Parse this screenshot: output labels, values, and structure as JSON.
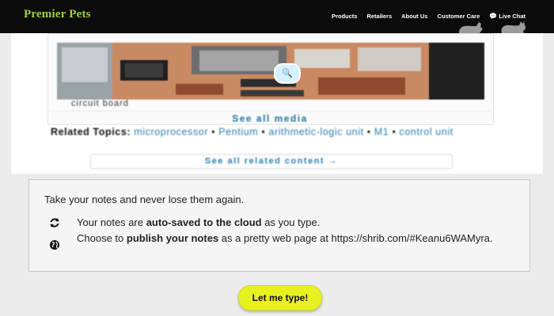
{
  "site": {
    "brand": "Premier Pets",
    "nav": [
      "Products",
      "Retailers",
      "About Us",
      "Customer Care",
      "Live Chat"
    ],
    "icons": {
      "live_chat": "chat-bubbles-icon",
      "pets": "cat-and-dog-silhouette-icon"
    },
    "colors": {
      "bar": "#0b0b0b",
      "brand": "#9bd43c"
    }
  },
  "article": {
    "media_caption": "circuit board",
    "see_all_media": "See all media",
    "related_label": "Related Topics:",
    "related_links": [
      "microprocessor",
      "Pentium",
      "arithmetic-logic unit",
      "M1",
      "control unit"
    ],
    "see_related": "See all related content →",
    "icons": {
      "zoom": "magnify-icon"
    }
  },
  "notes": {
    "intro": "Take your notes and never lose them again.",
    "feature1": {
      "icon": "refresh-icon",
      "pre": "Your notes are ",
      "bold": "auto-saved to the cloud",
      "post": " as you type."
    },
    "feature2": {
      "icon": "globe-icon",
      "pre": "Choose to ",
      "bold": "publish your notes",
      "post": " as a pretty web page at https://shrib.com/#Keanu6WAMyra."
    }
  },
  "cta": {
    "label": "Let me type!",
    "color": "#e9f01f"
  }
}
